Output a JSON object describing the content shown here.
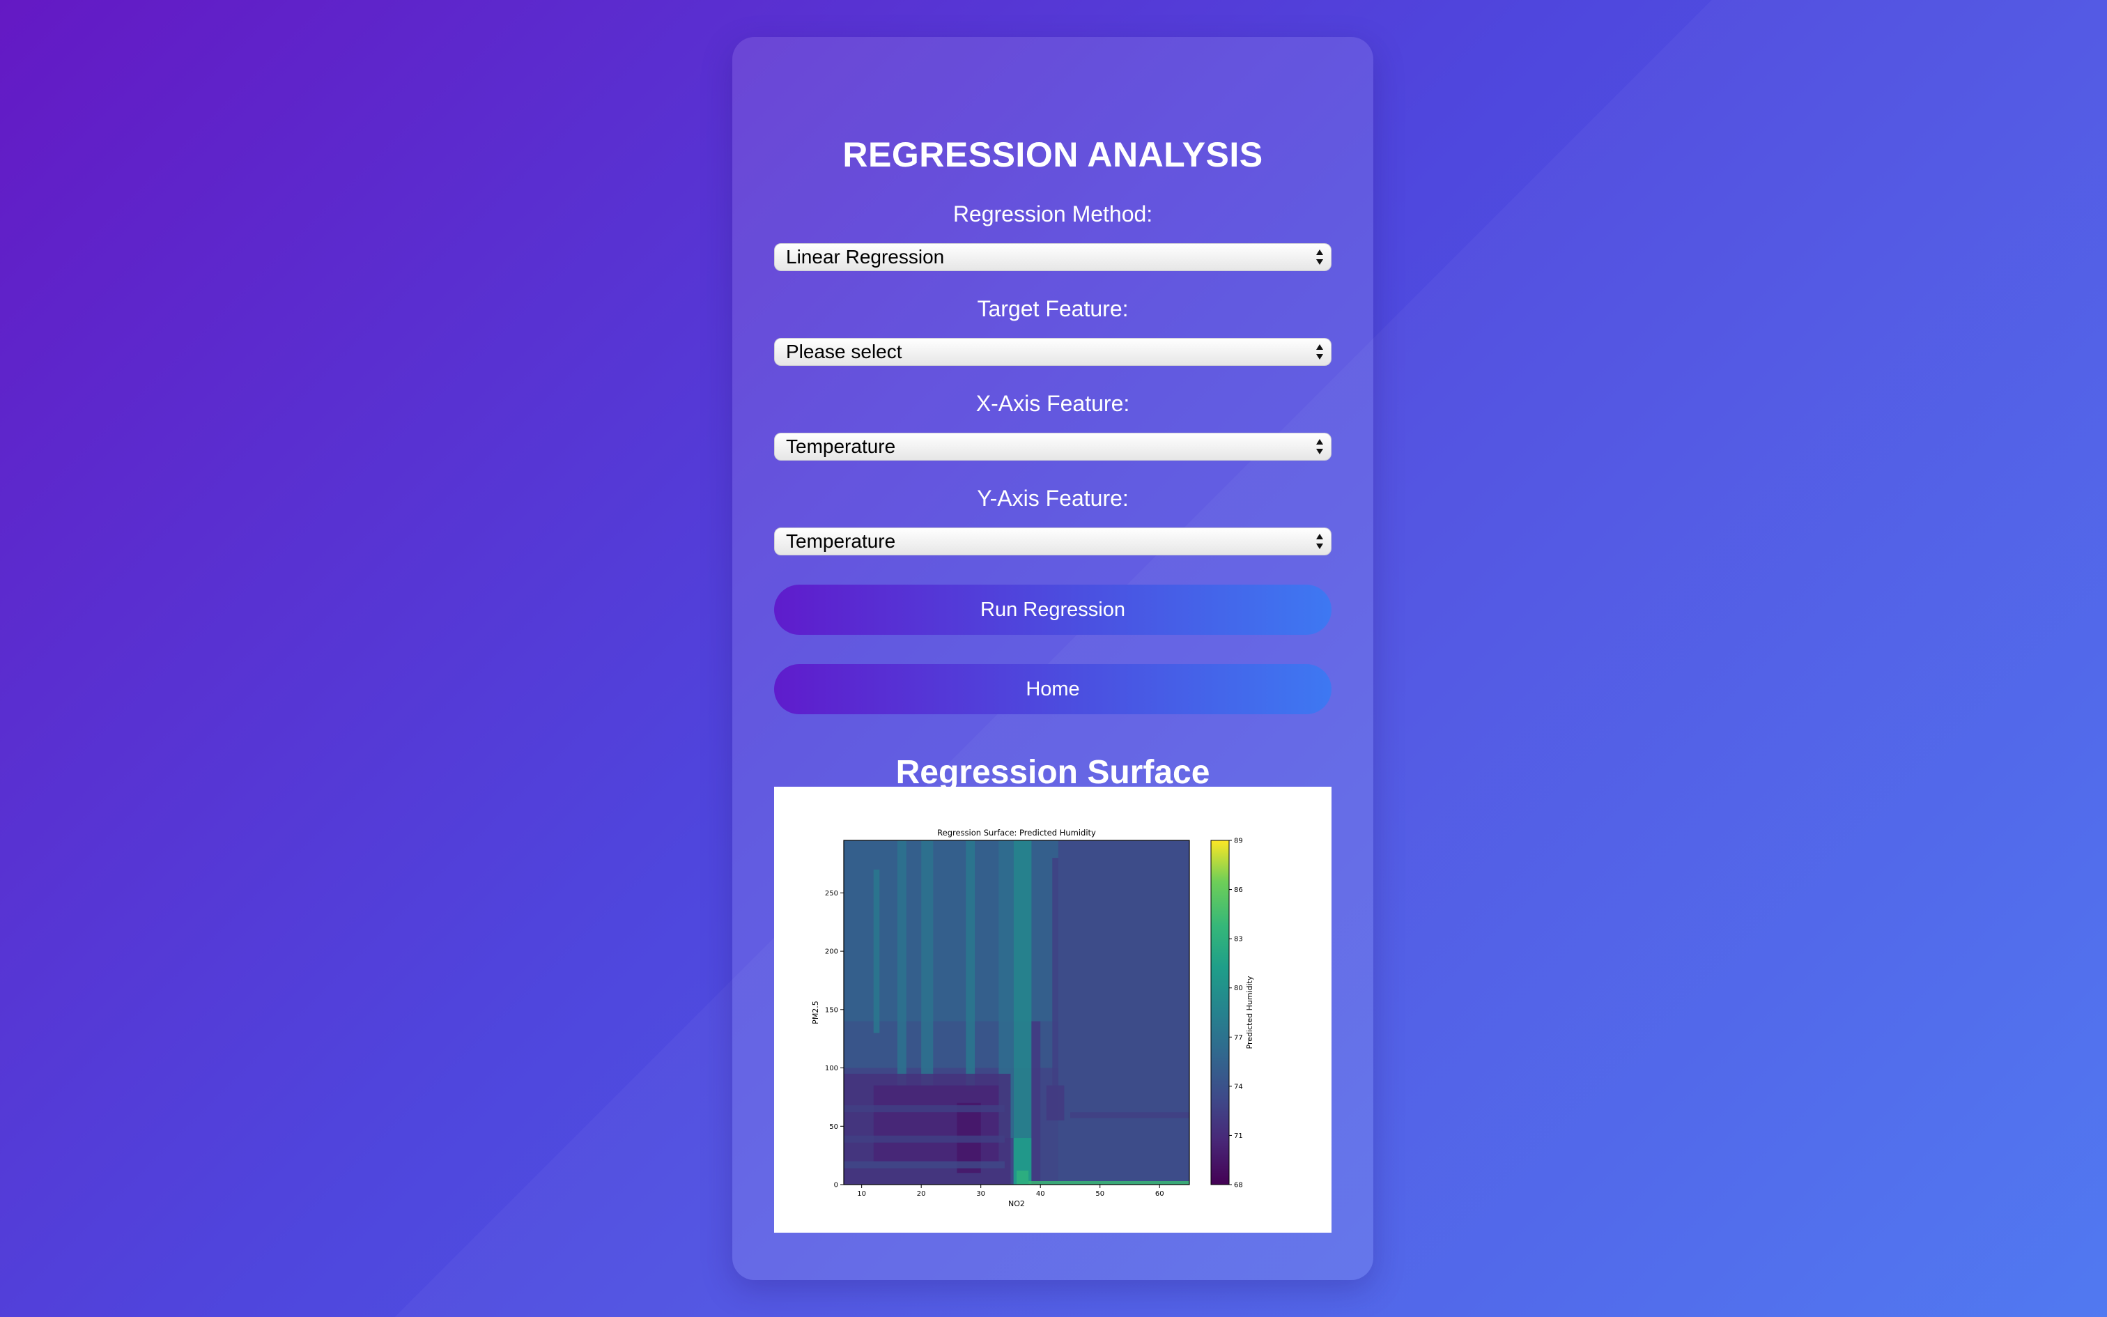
{
  "page": {
    "title": "REGRESSION ANALYSIS"
  },
  "form": {
    "regression_method": {
      "label": "Regression Method:",
      "selected": "Linear Regression"
    },
    "target_feature": {
      "label": "Target Feature:",
      "selected": "Please select"
    },
    "x_axis_feature": {
      "label": "X-Axis Feature:",
      "selected": "Temperature"
    },
    "y_axis_feature": {
      "label": "Y-Axis Feature:",
      "selected": "Temperature"
    },
    "run_button": "Run Regression",
    "home_button": "Home"
  },
  "results": {
    "section_title": "Regression Surface"
  },
  "colors": {
    "gradient_start": "#5f1ccc",
    "gradient_end": "#3e78f2",
    "surface_dominant": "#3b5690"
  },
  "chart_data": {
    "type": "heatmap",
    "title": "Regression Surface: Predicted Humidity",
    "xlabel": "NO2",
    "ylabel": "PM2.5",
    "xlim": [
      7,
      65
    ],
    "ylim": [
      0,
      295
    ],
    "x_ticks": [
      10,
      20,
      30,
      40,
      50,
      60
    ],
    "y_ticks": [
      0,
      50,
      100,
      150,
      200,
      250
    ],
    "colormap": "viridis",
    "colorbar": {
      "label": "Predicted Humidity",
      "range": [
        68,
        89
      ],
      "ticks": [
        68,
        71,
        74,
        77,
        80,
        83,
        86,
        89
      ]
    },
    "background_value": 73.5,
    "regions": [
      {
        "x": [
          7,
          43
        ],
        "y": [
          140,
          295
        ],
        "value": 75.5
      },
      {
        "x": [
          7,
          43
        ],
        "y": [
          100,
          140
        ],
        "value": 74.5
      },
      {
        "x": [
          7,
          43
        ],
        "y": [
          0,
          100
        ],
        "value": 73
      },
      {
        "x": [
          12,
          13
        ],
        "y": [
          130,
          270
        ],
        "value": 77.5
      },
      {
        "x": [
          16,
          17.5
        ],
        "y": [
          50,
          295
        ],
        "value": 77
      },
      {
        "x": [
          20,
          22
        ],
        "y": [
          50,
          295
        ],
        "value": 77
      },
      {
        "x": [
          27.5,
          29
        ],
        "y": [
          80,
          295
        ],
        "value": 77.5
      },
      {
        "x": [
          35.5,
          38.5
        ],
        "y": [
          0,
          295
        ],
        "value": 79
      },
      {
        "x": [
          33,
          35.5
        ],
        "y": [
          40,
          295
        ],
        "value": 76.5
      },
      {
        "x": [
          7,
          35
        ],
        "y": [
          0,
          95
        ],
        "value": 71.5
      },
      {
        "x": [
          12,
          33
        ],
        "y": [
          20,
          85
        ],
        "value": 70.5
      },
      {
        "x": [
          26,
          30
        ],
        "y": [
          10,
          70
        ],
        "value": 69.5
      },
      {
        "x": [
          7,
          34
        ],
        "y": [
          62,
          68
        ],
        "value": 72.5
      },
      {
        "x": [
          7,
          34
        ],
        "y": [
          36,
          42
        ],
        "value": 72.5
      },
      {
        "x": [
          7,
          34
        ],
        "y": [
          14,
          20
        ],
        "value": 73
      },
      {
        "x": [
          35.5,
          38.5
        ],
        "y": [
          0,
          40
        ],
        "value": 81
      },
      {
        "x": [
          36,
          38
        ],
        "y": [
          0,
          12
        ],
        "value": 83
      },
      {
        "x": [
          38.5,
          40
        ],
        "y": [
          0,
          140
        ],
        "value": 72
      },
      {
        "x": [
          42,
          43
        ],
        "y": [
          85,
          280
        ],
        "value": 72.5
      },
      {
        "x": [
          41,
          44
        ],
        "y": [
          55,
          85
        ],
        "value": 72
      },
      {
        "x": [
          45,
          65
        ],
        "y": [
          57,
          62
        ],
        "value": 72.5
      },
      {
        "x": [
          38,
          65
        ],
        "y": [
          0,
          3
        ],
        "value": 84
      }
    ]
  }
}
